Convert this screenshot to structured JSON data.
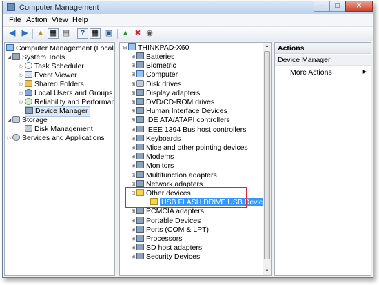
{
  "window": {
    "title": "Computer Management"
  },
  "menu": [
    "File",
    "Action",
    "View",
    "Help"
  ],
  "toolbar_icons": [
    "back-arrow-icon",
    "forward-arrow-icon",
    "up-folder-icon",
    "show-hide-tree-icon",
    "properties-icon",
    "help-icon",
    "console-tree-icon",
    "scan-hardware-icon",
    "update-driver-icon",
    "uninstall-device-icon",
    "disable-device-icon"
  ],
  "tree": [
    {
      "label": "Computer Management (Local)",
      "icon": "computer-icon",
      "expander": "",
      "level": 0
    },
    {
      "label": "System Tools",
      "icon": "tools-icon",
      "expander": "collapse",
      "level": 1
    },
    {
      "label": "Task Scheduler",
      "icon": "clock-icon",
      "expander": "expand",
      "level": 2
    },
    {
      "label": "Event Viewer",
      "icon": "log-icon",
      "expander": "expand",
      "level": 2
    },
    {
      "label": "Shared Folders",
      "icon": "folder-icon",
      "expander": "expand",
      "level": 2
    },
    {
      "label": "Local Users and Groups",
      "icon": "users-icon",
      "expander": "expand",
      "level": 2
    },
    {
      "label": "Reliability and Performance",
      "icon": "gauge-icon",
      "expander": "expand",
      "level": 2
    },
    {
      "label": "Device Manager",
      "icon": "device-manager-icon",
      "expander": "",
      "level": 2,
      "selected": true
    },
    {
      "label": "Storage",
      "icon": "storage-icon",
      "expander": "collapse",
      "level": 1
    },
    {
      "label": "Disk Management",
      "icon": "disk-icon",
      "expander": "",
      "level": 2
    },
    {
      "label": "Services and Applications",
      "icon": "services-icon",
      "expander": "expand",
      "level": 1
    }
  ],
  "devices": {
    "root": "THINKPAD-X60",
    "items": [
      {
        "label": "Batteries",
        "icon": "battery-icon",
        "expander": "expand"
      },
      {
        "label": "Biometric",
        "icon": "biometric-icon",
        "expander": "expand"
      },
      {
        "label": "Computer",
        "icon": "computer-icon",
        "expander": "expand"
      },
      {
        "label": "Disk drives",
        "icon": "disk-drive-icon",
        "expander": "expand"
      },
      {
        "label": "Display adapters",
        "icon": "display-icon",
        "expander": "expand"
      },
      {
        "label": "DVD/CD-ROM drives",
        "icon": "dvd-icon",
        "expander": "expand"
      },
      {
        "label": "Human Interface Devices",
        "icon": "hid-icon",
        "expander": "expand"
      },
      {
        "label": "IDE ATA/ATAPI controllers",
        "icon": "ide-icon",
        "expander": "expand"
      },
      {
        "label": "IEEE 1394 Bus host controllers",
        "icon": "ieee1394-icon",
        "expander": "expand"
      },
      {
        "label": "Keyboards",
        "icon": "keyboard-icon",
        "expander": "expand"
      },
      {
        "label": "Mice and other pointing devices",
        "icon": "mouse-icon",
        "expander": "expand"
      },
      {
        "label": "Modems",
        "icon": "modem-icon",
        "expander": "expand"
      },
      {
        "label": "Monitors",
        "icon": "monitor-icon",
        "expander": "expand"
      },
      {
        "label": "Multifunction adapters",
        "icon": "multifunction-icon",
        "expander": "expand"
      },
      {
        "label": "Network adapters",
        "icon": "network-icon",
        "expander": "expand"
      },
      {
        "label": "Other devices",
        "icon": "other-devices-icon",
        "expander": "collapse"
      },
      {
        "label": "USB FLASH DRIVE USB Device",
        "icon": "warning-device-icon",
        "expander": "",
        "child": true,
        "highlighted": true
      },
      {
        "label": "PCMCIA adapters",
        "icon": "pcmcia-icon",
        "expander": "expand"
      },
      {
        "label": "Portable Devices",
        "icon": "portable-icon",
        "expander": "expand"
      },
      {
        "label": "Ports (COM & LPT)",
        "icon": "ports-icon",
        "expander": "expand"
      },
      {
        "label": "Processors",
        "icon": "processor-icon",
        "expander": "expand"
      },
      {
        "label": "SD host adapters",
        "icon": "sd-icon",
        "expander": "expand"
      },
      {
        "label": "Security Devices",
        "icon": "security-icon",
        "expander": "expand"
      }
    ]
  },
  "actions": {
    "header": "Actions",
    "section": "Device Manager",
    "more": "More Actions"
  },
  "colors": {
    "selection": "#3399ff",
    "callout": "#e0222c"
  }
}
